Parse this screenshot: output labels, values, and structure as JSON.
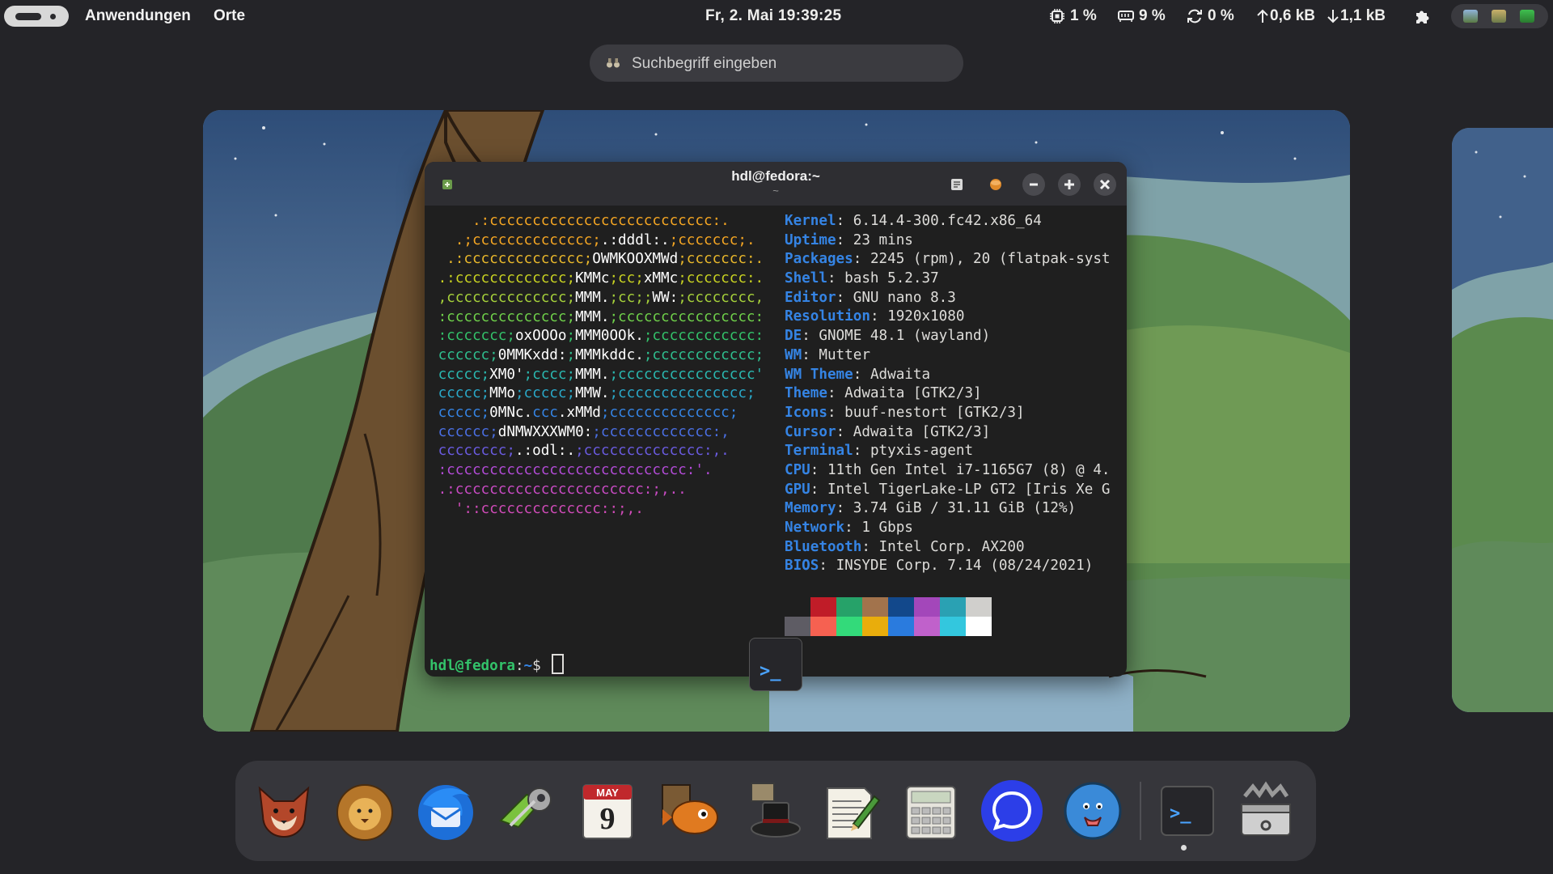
{
  "topbar": {
    "menu_apps": "Anwendungen",
    "menu_places": "Orte",
    "clock": "Fr, 2. Mai  19:39:25",
    "cpu": "1 %",
    "memory": "9 %",
    "swap": "0 %",
    "upload": "0,6 kB",
    "download": "1,1 kB"
  },
  "search": {
    "placeholder": "Suchbegriff eingeben"
  },
  "terminal": {
    "title": "hdl@fedora:~",
    "subtitle": "~",
    "ascii_lines": [
      {
        "parts": [
          {
            "t": "     .:cccccccccccccccccccccccccc:.",
            "c": "#f5a623"
          }
        ]
      },
      {
        "parts": [
          {
            "t": "   .;cccccccccccccc;",
            "c": "#f5a623"
          },
          {
            "t": ".:dddl:.",
            "c": "#ffffff"
          },
          {
            "t": ";ccccccc;.",
            "c": "#f5a623"
          }
        ]
      },
      {
        "parts": [
          {
            "t": "  .:cccccccccccccc;",
            "c": "#e9b82b"
          },
          {
            "t": "OWMKOOXMWd",
            "c": "#ffffff"
          },
          {
            "t": ";ccccccc:.",
            "c": "#e9b82b"
          }
        ]
      },
      {
        "parts": [
          {
            "t": " .:ccccccccccccc;",
            "c": "#c9d321"
          },
          {
            "t": "KMMc",
            "c": "#ffffff"
          },
          {
            "t": ";cc;",
            "c": "#c9d321"
          },
          {
            "t": "xMMc",
            "c": "#ffffff"
          },
          {
            "t": ";ccccccc:.",
            "c": "#c9d321"
          }
        ]
      },
      {
        "parts": [
          {
            "t": " ,cccccccccccccc;",
            "c": "#a6d13a"
          },
          {
            "t": "MMM.",
            "c": "#ffffff"
          },
          {
            "t": ";cc;;",
            "c": "#a6d13a"
          },
          {
            "t": "WW:",
            "c": "#ffffff"
          },
          {
            "t": ";cccccccc,",
            "c": "#a6d13a"
          }
        ]
      },
      {
        "parts": [
          {
            "t": " :cccccccccccccc;",
            "c": "#6fd14a"
          },
          {
            "t": "MMM.",
            "c": "#ffffff"
          },
          {
            "t": ";cccccccccccccccc:",
            "c": "#6fd14a"
          }
        ]
      },
      {
        "parts": [
          {
            "t": " :ccccccc;",
            "c": "#33c26a"
          },
          {
            "t": "oxOOOo",
            "c": "#ffffff"
          },
          {
            "t": ";",
            "c": "#33c26a"
          },
          {
            "t": "MMM0OOk.",
            "c": "#ffffff"
          },
          {
            "t": ";cccccccccccc:",
            "c": "#33c26a"
          }
        ]
      },
      {
        "parts": [
          {
            "t": " cccccc;",
            "c": "#2fbf8f"
          },
          {
            "t": "0MMKxdd:",
            "c": "#ffffff"
          },
          {
            "t": ";",
            "c": "#2fbf8f"
          },
          {
            "t": "MMMkddc.",
            "c": "#ffffff"
          },
          {
            "t": ";cccccccccccc;",
            "c": "#2fbf8f"
          }
        ]
      },
      {
        "parts": [
          {
            "t": " ccccc;",
            "c": "#2ab8b0"
          },
          {
            "t": "XM0'",
            "c": "#ffffff"
          },
          {
            "t": ";cccc;",
            "c": "#2ab8b0"
          },
          {
            "t": "MMM.",
            "c": "#ffffff"
          },
          {
            "t": ";cccccccccccccccc'",
            "c": "#2ab8b0"
          }
        ]
      },
      {
        "parts": [
          {
            "t": " ccccc;",
            "c": "#2aa8c8"
          },
          {
            "t": "MMo",
            "c": "#ffffff"
          },
          {
            "t": ";ccccc;",
            "c": "#2aa8c8"
          },
          {
            "t": "MMW.",
            "c": "#ffffff"
          },
          {
            "t": ";ccccccccccccccc;",
            "c": "#2aa8c8"
          }
        ]
      },
      {
        "parts": [
          {
            "t": " ccccc;",
            "c": "#3584e4"
          },
          {
            "t": "0MNc.",
            "c": "#ffffff"
          },
          {
            "t": "ccc",
            "c": "#3584e4"
          },
          {
            "t": ".xMMd",
            "c": "#ffffff"
          },
          {
            "t": ";cccccccccccccc;",
            "c": "#3584e4"
          }
        ]
      },
      {
        "parts": [
          {
            "t": " cccccc;",
            "c": "#4a6fe3"
          },
          {
            "t": "dNMWXXXWM0:",
            "c": "#ffffff"
          },
          {
            "t": ";ccccccccccccc:,",
            "c": "#4a6fe3"
          }
        ]
      },
      {
        "parts": [
          {
            "t": " cccccccc;",
            "c": "#6a5be0"
          },
          {
            "t": ".:odl:.",
            "c": "#ffffff"
          },
          {
            "t": ";cccccccccccccc:,.",
            "c": "#6a5be0"
          }
        ]
      },
      {
        "parts": [
          {
            "t": " :cccccccccccccccccccccccccccc:'.",
            "c": "#b24bd6"
          }
        ]
      },
      {
        "parts": [
          {
            "t": " .:cccccccccccccccccccccc:;,..",
            "c": "#c94bc4"
          }
        ]
      },
      {
        "parts": [
          {
            "t": "   '::cccccccccccccc::;,.",
            "c": "#d04bb8"
          }
        ]
      }
    ],
    "info": [
      {
        "key": "Kernel",
        "value": "6.14.4-300.fc42.x86_64"
      },
      {
        "key": "Uptime",
        "value": "23 mins"
      },
      {
        "key": "Packages",
        "value": "2245 (rpm), 20 (flatpak-syst"
      },
      {
        "key": "Shell",
        "value": "bash 5.2.37"
      },
      {
        "key": "Editor",
        "value": "GNU nano 8.3"
      },
      {
        "key": "Resolution",
        "value": "1920x1080"
      },
      {
        "key": "DE",
        "value": "GNOME 48.1 (wayland)"
      },
      {
        "key": "WM",
        "value": "Mutter"
      },
      {
        "key": "WM Theme",
        "value": "Adwaita"
      },
      {
        "key": "Theme",
        "value": "Adwaita [GTK2/3]"
      },
      {
        "key": "Icons",
        "value": "buuf-nestort [GTK2/3]"
      },
      {
        "key": "Cursor",
        "value": "Adwaita [GTK2/3]"
      },
      {
        "key": "Terminal",
        "value": "ptyxis-agent"
      },
      {
        "key": "CPU",
        "value": "11th Gen Intel i7-1165G7 (8) @ 4."
      },
      {
        "key": "GPU",
        "value": "Intel TigerLake-LP GT2 [Iris Xe G"
      },
      {
        "key": "Memory",
        "value": "3.74 GiB / 31.11 GiB (12%)"
      },
      {
        "key": "Network",
        "value": "1 Gbps"
      },
      {
        "key": "Bluetooth",
        "value": "Intel Corp. AX200"
      },
      {
        "key": "BIOS",
        "value": "INSYDE Corp. 7.14 (08/24/2021)"
      }
    ],
    "palette_top": [
      "#1f1f1f",
      "#c01c28",
      "#26a269",
      "#a2734c",
      "#12488b",
      "#a347ba",
      "#2aa1b3",
      "#d0cfcc"
    ],
    "palette_bottom": [
      "#5e5c64",
      "#f66151",
      "#33da7a",
      "#e9ad0c",
      "#2a7bde",
      "#c061cb",
      "#33c7de",
      "#ffffff"
    ],
    "prompt_user": "hdl@fedora",
    "prompt_sep": ":",
    "prompt_path": "~",
    "prompt_symbol": "$ ",
    "thumb_glyph": ">_"
  },
  "calendar_icon": {
    "month": "MAY",
    "day": "9"
  },
  "dock_terminal_glyph": ">_",
  "colors": {
    "accent": "#3584e4",
    "prompt_green": "#33c26a",
    "panel_bg": "#242428",
    "dock_bg": "#36363b"
  },
  "dock_apps": [
    "fox-browser-icon",
    "lion-icon",
    "thunderbird-mail-icon",
    "keys-icon",
    "calendar-icon",
    "fish-app-icon",
    "magic-hat-icon",
    "text-editor-icon",
    "calculator-icon",
    "signal-messenger-icon",
    "chat-bubble-icon",
    "terminal-icon",
    "software-toolbox-icon"
  ]
}
